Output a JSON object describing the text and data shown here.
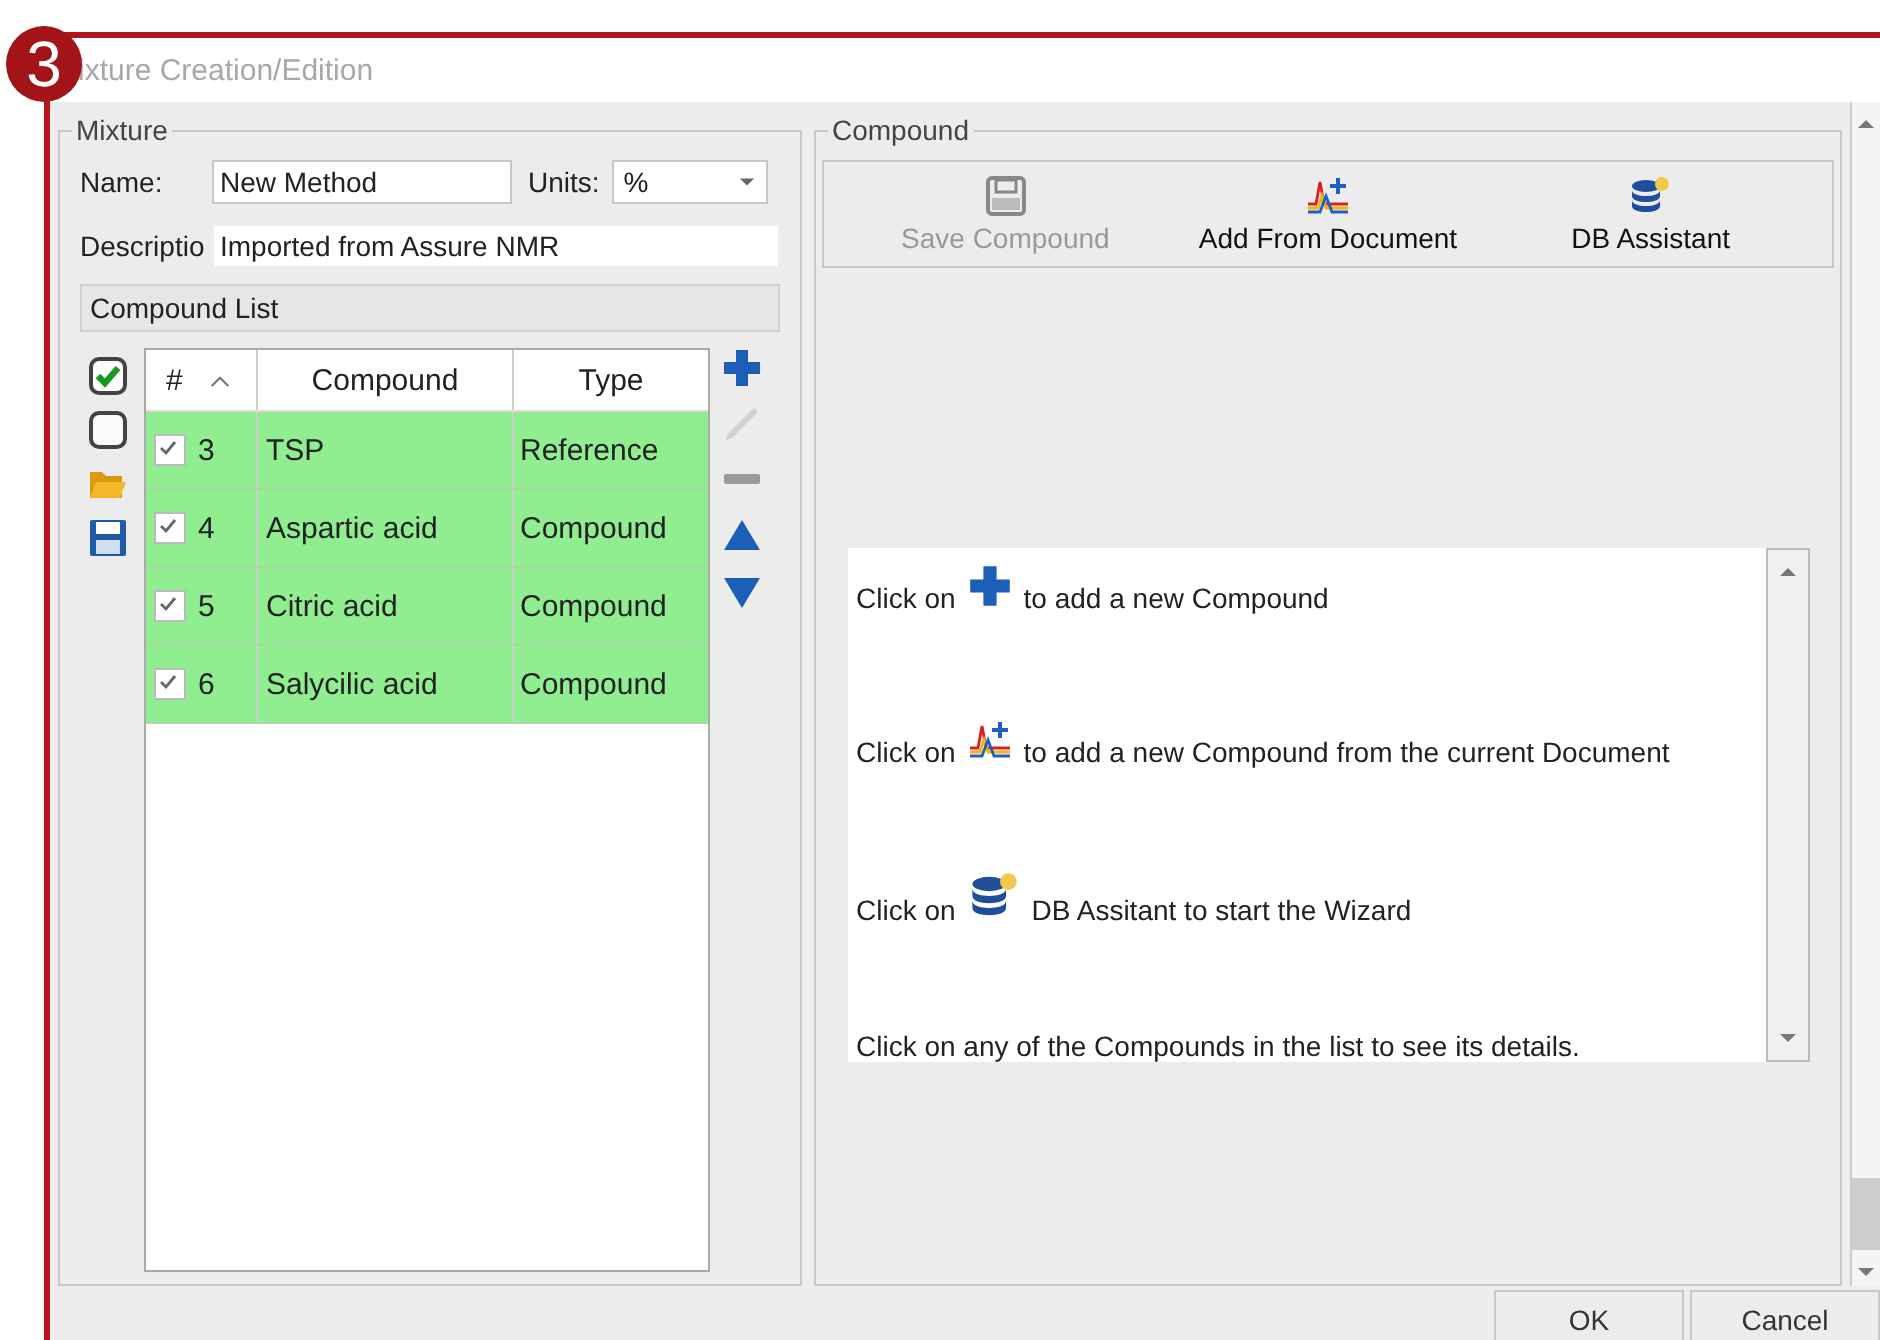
{
  "annotation": {
    "number": "3"
  },
  "window": {
    "title": "ixture Creation/Edition"
  },
  "mixture": {
    "legend": "Mixture",
    "name_label": "Name:",
    "name_value": "New Method",
    "units_label": "Units:",
    "units_value": "%",
    "description_label": "Descriptio",
    "description_value": "Imported from Assure NMR",
    "compound_list_title": "Compound List",
    "left_tools": [
      {
        "kind": "check_all"
      },
      {
        "kind": "uncheck_all"
      },
      {
        "kind": "open"
      },
      {
        "kind": "save"
      }
    ],
    "table": {
      "columns": [
        "#",
        "Compound",
        "Type"
      ],
      "rows": [
        {
          "checked": true,
          "number": "3",
          "compound": "TSP",
          "type": "Reference"
        },
        {
          "checked": true,
          "number": "4",
          "compound": "Aspartic acid",
          "type": "Compound"
        },
        {
          "checked": true,
          "number": "5",
          "compound": "Citric acid",
          "type": "Compound"
        },
        {
          "checked": true,
          "number": "6",
          "compound": "Salycilic acid",
          "type": "Compound"
        }
      ]
    },
    "side_tools": [
      {
        "kind": "add"
      },
      {
        "kind": "edit"
      },
      {
        "kind": "remove"
      },
      {
        "kind": "up"
      },
      {
        "kind": "down"
      }
    ]
  },
  "compound": {
    "legend": "Compound",
    "toolbar": [
      {
        "kind": "save",
        "label": "Save Compound",
        "disabled": true
      },
      {
        "kind": "add_from_document",
        "label": "Add From Document",
        "disabled": false
      },
      {
        "kind": "db_assistant",
        "label": "DB Assistant",
        "disabled": false
      }
    ],
    "help": [
      {
        "kind": "add",
        "before": "Click on",
        "after": "to add a new Compound"
      },
      {
        "kind": "add_from_document",
        "before": "Click on",
        "after": "to add a new Compound from the current Document"
      },
      {
        "kind": "db_assistant",
        "before": "Click on",
        "after": "DB Assitant to start the Wizard"
      },
      {
        "kind": "text",
        "before": "Click on any of the Compounds in the list to see its details."
      }
    ]
  },
  "buttons": [
    {
      "label": "OK"
    },
    {
      "label": "Cancel"
    }
  ]
}
